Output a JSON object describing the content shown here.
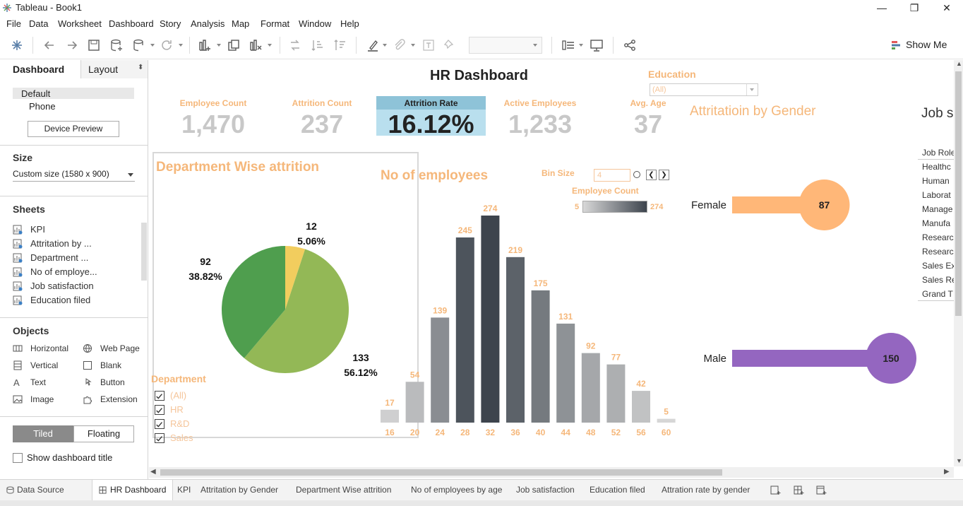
{
  "window": {
    "title": "Tableau - Book1",
    "minimize": "—",
    "maximize": "❐",
    "close": "✕"
  },
  "menu": [
    "File",
    "Data",
    "Worksheet",
    "Dashboard",
    "Story",
    "Analysis",
    "Map",
    "Format",
    "Window",
    "Help"
  ],
  "toolbar": {
    "show_me": "Show Me"
  },
  "left_panel": {
    "tabs": {
      "dashboard": "Dashboard",
      "layout": "Layout"
    },
    "devices": {
      "default": "Default",
      "phone": "Phone",
      "preview_button": "Device Preview"
    },
    "size": {
      "heading": "Size",
      "value": "Custom size (1580 x 900)"
    },
    "sheets": {
      "heading": "Sheets",
      "items": [
        "KPI",
        "Attritation by ...",
        "Department ...",
        "No of employe...",
        "Job satisfaction",
        "Education filed"
      ]
    },
    "objects": {
      "heading": "Objects",
      "items": [
        "Horizontal",
        "Web Page",
        "Vertical",
        "Blank",
        "Text",
        "Button",
        "Image",
        "Extension"
      ]
    },
    "tiled": "Tiled",
    "floating": "Floating",
    "show_title": "Show dashboard title"
  },
  "dashboard": {
    "title": "HR Dashboard",
    "education_filter": {
      "label": "Education",
      "value": "(All)"
    },
    "kpis": [
      {
        "label": "Employee Count",
        "value": "1,470"
      },
      {
        "label": "Attrition Count",
        "value": "237"
      },
      {
        "label": "Attrition Rate",
        "value": "16.12%"
      },
      {
        "label": "Active Employees",
        "value": "1,233"
      },
      {
        "label": "Avg. Age",
        "value": "37"
      }
    ],
    "dept_title": "Department Wise attrition",
    "dept_filter": {
      "label": "Department",
      "items": [
        "(All)",
        "HR",
        "R&D",
        "Sales"
      ]
    },
    "age_title": "No of employees",
    "bin_size": {
      "label": "Bin Size",
      "value": "4"
    },
    "legend": {
      "title": "Employee Count",
      "min": "5",
      "max": "274"
    },
    "gender_title": "Attritatioin by Gender",
    "job_title": "Job s",
    "job_roles": [
      "Job Role",
      "Healthc",
      "Human",
      "Laborat",
      "Manage",
      "Manufa",
      "Researc",
      "Researc",
      "Sales Ex",
      "Sales Re",
      "Grand T"
    ]
  },
  "chart_data": [
    {
      "type": "pie",
      "title": "Department Wise attrition",
      "slices": [
        {
          "value": 12,
          "percent": "5.06%",
          "color": "#f2cd5e"
        },
        {
          "value": 133,
          "percent": "56.12%",
          "color": "#93b856"
        },
        {
          "value": 92,
          "percent": "38.82%",
          "color": "#4f9e4e"
        }
      ]
    },
    {
      "type": "bar",
      "title": "No of employees",
      "categories": [
        "16",
        "20",
        "24",
        "28",
        "32",
        "36",
        "40",
        "44",
        "48",
        "52",
        "56",
        "60"
      ],
      "values": [
        17,
        54,
        139,
        245,
        274,
        219,
        175,
        131,
        92,
        77,
        42,
        5
      ],
      "color_min": "#d6d6d6",
      "color_max": "#3d444d"
    },
    {
      "type": "bar",
      "title": "Attritatioin by Gender",
      "categories": [
        "Female",
        "Male"
      ],
      "values": [
        87,
        150
      ],
      "colors": [
        "#ffb778",
        "#9466c0"
      ]
    }
  ],
  "bottom_tabs": [
    "Data Source",
    "HR Dashboard",
    "KPI",
    "Attritation by Gender",
    "Department Wise attrition",
    "No of employees by age",
    "Job satisfaction",
    "Education filed",
    "Attration rate by gender"
  ]
}
